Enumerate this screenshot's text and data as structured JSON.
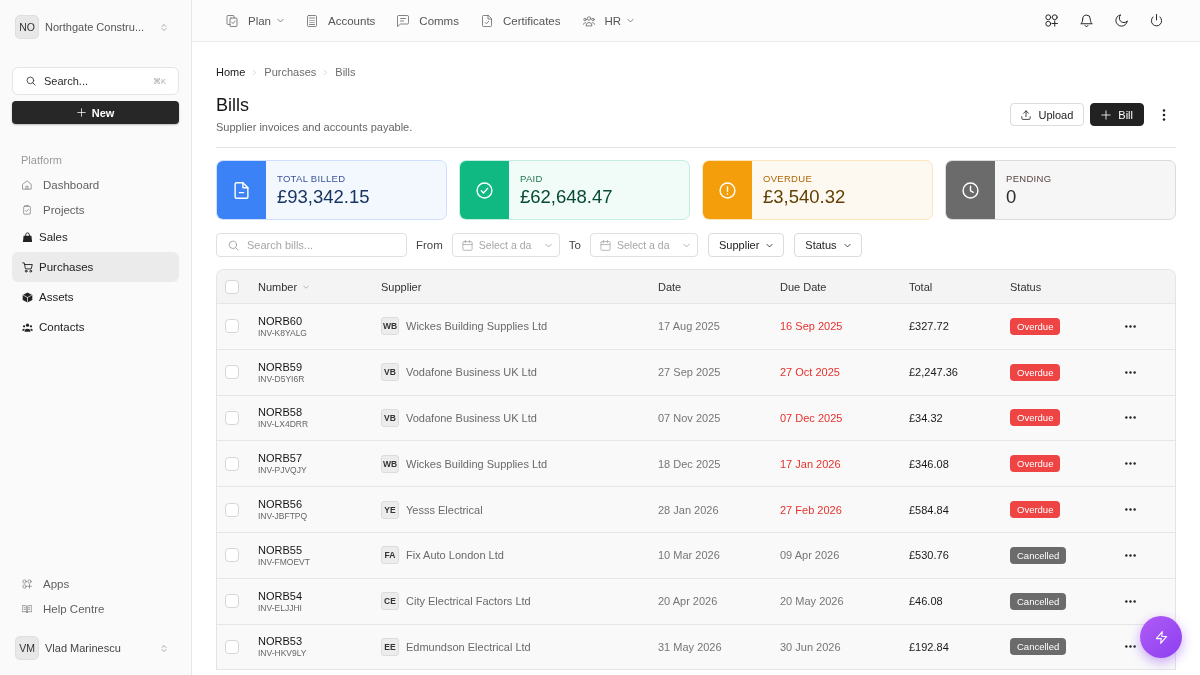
{
  "sidebar": {
    "organization": {
      "initials": "NO",
      "name": "Northgate Constru..."
    },
    "search": {
      "placeholder": "Search...",
      "shortcut": "⌘K"
    },
    "new_button": {
      "label": "New"
    },
    "section_label": "Platform",
    "items": [
      {
        "label": "Dashboard",
        "kind": "link",
        "selected": false
      },
      {
        "label": "Projects",
        "kind": "link",
        "selected": false
      },
      {
        "label": "Sales",
        "kind": "module",
        "selected": false
      },
      {
        "label": "Purchases",
        "kind": "module",
        "selected": true
      },
      {
        "label": "Assets",
        "kind": "module",
        "selected": false
      },
      {
        "label": "Contacts",
        "kind": "module",
        "selected": false
      }
    ],
    "footer_items": [
      {
        "label": "Apps",
        "kind": "link",
        "selected": false
      },
      {
        "label": "Help Centre",
        "kind": "link",
        "selected": false
      }
    ],
    "user": {
      "initials": "VM",
      "name": "Vlad Marinescu"
    }
  },
  "top_nav": {
    "items": [
      {
        "label": "Plan",
        "has_menu": true
      },
      {
        "label": "Accounts",
        "has_menu": false
      },
      {
        "label": "Comms",
        "has_menu": false
      },
      {
        "label": "Certificates",
        "has_menu": false
      },
      {
        "label": "HR",
        "has_menu": true
      }
    ]
  },
  "breadcrumb": [
    {
      "label": "Home",
      "emphasized": true
    },
    {
      "label": "Purchases",
      "emphasized": false
    },
    {
      "label": "Bills",
      "emphasized": false
    }
  ],
  "page": {
    "title": "Bills",
    "subtitle": "Supplier invoices and accounts payable.",
    "actions": [
      {
        "label": "Upload",
        "kind": "secondary"
      },
      {
        "label": "Bill",
        "kind": "primary"
      }
    ]
  },
  "stats": [
    {
      "label": "TOTAL BILLED",
      "value": "£93,342.15",
      "color": "#3b82f6"
    },
    {
      "label": "PAID",
      "value": "£62,648.47",
      "color": "#10b981"
    },
    {
      "label": "OVERDUE",
      "value": "£3,540.32",
      "color": "#f59e0b"
    },
    {
      "label": "PENDING",
      "value": "0",
      "color": "#6b6b6b"
    }
  ],
  "filters": {
    "search": {
      "placeholder": "Search bills..."
    },
    "date_from": {
      "label": "From",
      "placeholder": "Select a da"
    },
    "date_to": {
      "label": "To",
      "placeholder": "Select a da"
    },
    "dropdowns": [
      {
        "label": "Supplier"
      },
      {
        "label": "Status"
      }
    ]
  },
  "table": {
    "select_all": {
      "checked": false
    },
    "columns": [
      {
        "label": "Number",
        "sorted": true
      },
      {
        "label": "Supplier",
        "sorted": false
      },
      {
        "label": "Date",
        "sorted": false
      },
      {
        "label": "Due Date",
        "sorted": false
      },
      {
        "label": "Total",
        "sorted": false
      },
      {
        "label": "Status",
        "sorted": false
      }
    ],
    "rows": [
      {
        "checked": false,
        "number": "NORB60",
        "reference": "INV-K8YALG",
        "supplier_initials": "WB",
        "supplier": "Wickes Building Supplies Ltd",
        "date": "17 Aug 2025",
        "due_date": "16 Sep 2025",
        "total": "£327.72",
        "status": {
          "label": "Overdue",
          "kind": "overdue"
        }
      },
      {
        "checked": false,
        "number": "NORB59",
        "reference": "INV-D5YI6R",
        "supplier_initials": "VB",
        "supplier": "Vodafone Business UK Ltd",
        "date": "27 Sep 2025",
        "due_date": "27 Oct 2025",
        "total": "£2,247.36",
        "status": {
          "label": "Overdue",
          "kind": "overdue"
        }
      },
      {
        "checked": false,
        "number": "NORB58",
        "reference": "INV-LX4DRR",
        "supplier_initials": "VB",
        "supplier": "Vodafone Business UK Ltd",
        "date": "07 Nov 2025",
        "due_date": "07 Dec 2025",
        "total": "£34.32",
        "status": {
          "label": "Overdue",
          "kind": "overdue"
        }
      },
      {
        "checked": false,
        "number": "NORB57",
        "reference": "INV-PJVQJY",
        "supplier_initials": "WB",
        "supplier": "Wickes Building Supplies Ltd",
        "date": "18 Dec 2025",
        "due_date": "17 Jan 2026",
        "total": "£346.08",
        "status": {
          "label": "Overdue",
          "kind": "overdue"
        }
      },
      {
        "checked": false,
        "number": "NORB56",
        "reference": "INV-JBFTPQ",
        "supplier_initials": "YE",
        "supplier": "Yesss Electrical",
        "date": "28 Jan 2026",
        "due_date": "27 Feb 2026",
        "total": "£584.84",
        "status": {
          "label": "Overdue",
          "kind": "overdue"
        }
      },
      {
        "checked": false,
        "number": "NORB55",
        "reference": "INV-FMOEVT",
        "supplier_initials": "FA",
        "supplier": "Fix Auto London Ltd",
        "date": "10 Mar 2026",
        "due_date": "09 Apr 2026",
        "total": "£530.76",
        "status": {
          "label": "Cancelled",
          "kind": "cancelled"
        }
      },
      {
        "checked": false,
        "number": "NORB54",
        "reference": "INV-ELJJHI",
        "supplier_initials": "CE",
        "supplier": "City Electrical Factors Ltd",
        "date": "20 Apr 2026",
        "due_date": "20 May 2026",
        "total": "£46.08",
        "status": {
          "label": "Cancelled",
          "kind": "cancelled"
        }
      },
      {
        "checked": false,
        "number": "NORB53",
        "reference": "INV-HKV9LY",
        "supplier_initials": "EE",
        "supplier": "Edmundson Electrical Ltd",
        "date": "31 May 2026",
        "due_date": "30 Jun 2026",
        "total": "£192.84",
        "status": {
          "label": "Cancelled",
          "kind": "cancelled"
        }
      }
    ]
  }
}
